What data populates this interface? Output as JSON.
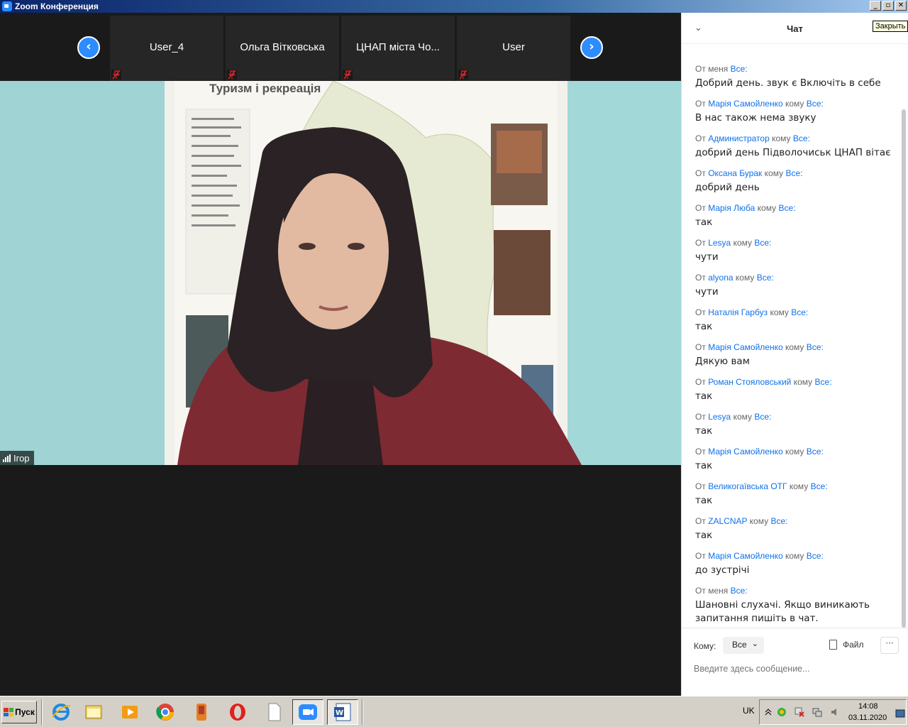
{
  "window": {
    "title": "Zoom Конференция",
    "buttons": [
      "_",
      "▫",
      "✕"
    ]
  },
  "tooltip": "Закрыть",
  "gallery": {
    "prev_icon": "‹",
    "next_icon": "›",
    "thumbnails": [
      {
        "name": "User_4",
        "muted": true
      },
      {
        "name": "Ольга Вітковська",
        "muted": true
      },
      {
        "name": "ЦНАП  міста Чо...",
        "muted": true
      },
      {
        "name": "User",
        "muted": true
      }
    ]
  },
  "active_speaker": {
    "name": "Ігор",
    "poster_title": "Туризм і рекреація"
  },
  "chat": {
    "title": "Чат",
    "collapse_icon": "chevron-down-icon",
    "from_label": "От",
    "to_label": "кому",
    "messages": [
      {
        "from": "меня",
        "to": "Все:",
        "text": "Добрий день. звук є Включіть в себе",
        "self": true
      },
      {
        "from": "Марія Самойленко",
        "to": "Все:",
        "text": "В нас також нема звуку"
      },
      {
        "from": "Администратор",
        "to": "Все:",
        "text": "добрий день Підволочиськ ЦНАП вітає"
      },
      {
        "from": "Оксана Бурак",
        "to": "Все:",
        "text": "добрий день"
      },
      {
        "from": "Марія Люба",
        "to": "Все:",
        "text": "так"
      },
      {
        "from": "Lesya",
        "to": "Все:",
        "text": "чути"
      },
      {
        "from": "alyona",
        "to": "Все:",
        "text": "чути"
      },
      {
        "from": "Наталія Гарбуз",
        "to": "Все:",
        "text": "так"
      },
      {
        "from": "Марія Самойленко",
        "to": "Все:",
        "text": "Дякую вам"
      },
      {
        "from": "Роман Стояловський",
        "to": "Все:",
        "text": "так"
      },
      {
        "from": "Lesya",
        "to": "Все:",
        "text": "так"
      },
      {
        "from": "Марія Самойленко",
        "to": "Все:",
        "text": "так"
      },
      {
        "from": "Великогаївська ОТГ",
        "to": "Все:",
        "text": "так"
      },
      {
        "from": "ZALCNAP",
        "to": "Все:",
        "text": "так"
      },
      {
        "from": "Марія Самойленко",
        "to": "Все:",
        "text": "до зустрічі"
      },
      {
        "from": "меня",
        "to": "Все:",
        "text": "Шановні слухачі. Якщо виникають\nзапитання пишіть в чат.",
        "self": true
      }
    ],
    "composer": {
      "to_label": "Кому:",
      "to_value": "Все",
      "file_label": "Файл",
      "more_label": "···",
      "placeholder": "Введите здесь сообщение..."
    }
  },
  "taskbar": {
    "start_label": "Пуск",
    "language": "UK",
    "time": "14:08",
    "date": "03.11.2020",
    "apps": [
      "internet-explorer-icon",
      "file-manager-icon",
      "media-player-icon",
      "chrome-icon",
      "app-icon",
      "opera-icon",
      "blank-document-icon",
      "zoom-icon",
      "word-icon"
    ]
  },
  "colors": {
    "zoom_blue": "#2d8cff",
    "chat_link": "#0e71eb",
    "mute_red": "#e02828"
  }
}
